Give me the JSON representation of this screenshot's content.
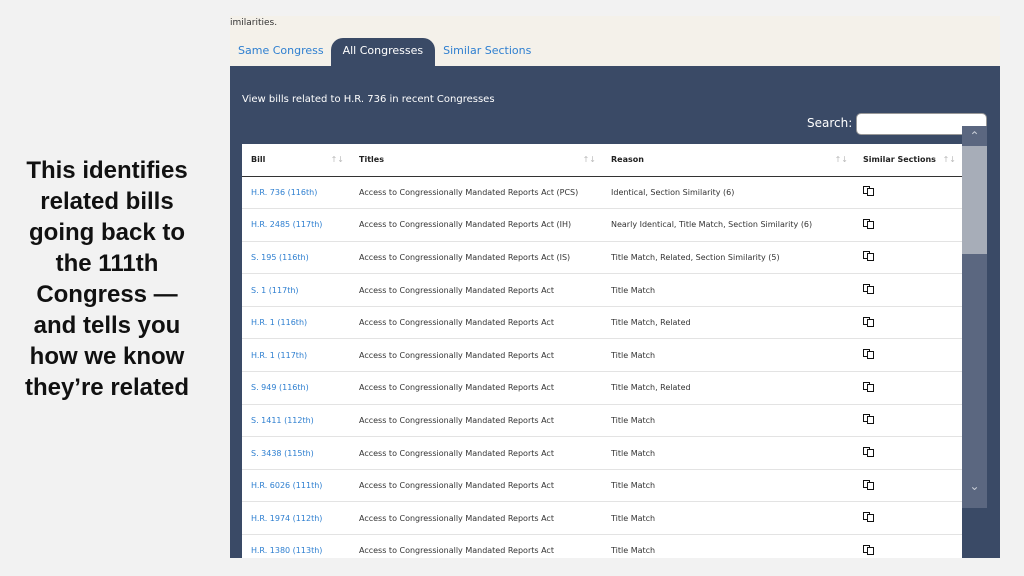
{
  "caption": "This identifies related bills going back to the 111th Congress — and tells you how we know they’re related",
  "top_text": "imilarities.",
  "tabs": [
    {
      "label": "Same Congress",
      "active": false
    },
    {
      "label": "All Congresses",
      "active": true
    },
    {
      "label": "Similar Sections",
      "active": false
    }
  ],
  "panel": {
    "description": "View bills related to H.R. 736 in recent Congresses",
    "search_label": "Search:",
    "search_value": ""
  },
  "table": {
    "headers": [
      "Bill",
      "Titles",
      "Reason",
      "Similar Sections"
    ],
    "sort_glyph": "↑↓",
    "rows": [
      {
        "bill": "H.R. 736 (116th)",
        "title": "Access to Congressionally Mandated Reports Act (PCS)",
        "reason": "Identical, Section Similarity (6)"
      },
      {
        "bill": "H.R. 2485 (117th)",
        "title": "Access to Congressionally Mandated Reports Act (IH)",
        "reason": "Nearly Identical, Title Match, Section Similarity (6)"
      },
      {
        "bill": "S. 195 (116th)",
        "title": "Access to Congressionally Mandated Reports Act (IS)",
        "reason": "Title Match, Related, Section Similarity (5)"
      },
      {
        "bill": "S. 1 (117th)",
        "title": "Access to Congressionally Mandated Reports Act",
        "reason": "Title Match"
      },
      {
        "bill": "H.R. 1 (116th)",
        "title": "Access to Congressionally Mandated Reports Act",
        "reason": "Title Match, Related"
      },
      {
        "bill": "H.R. 1 (117th)",
        "title": "Access to Congressionally Mandated Reports Act",
        "reason": "Title Match"
      },
      {
        "bill": "S. 949 (116th)",
        "title": "Access to Congressionally Mandated Reports Act",
        "reason": "Title Match, Related"
      },
      {
        "bill": "S. 1411 (112th)",
        "title": "Access to Congressionally Mandated Reports Act",
        "reason": "Title Match"
      },
      {
        "bill": "S. 3438 (115th)",
        "title": "Access to Congressionally Mandated Reports Act",
        "reason": "Title Match"
      },
      {
        "bill": "H.R. 6026 (111th)",
        "title": "Access to Congressionally Mandated Reports Act",
        "reason": "Title Match"
      },
      {
        "bill": "H.R. 1974 (112th)",
        "title": "Access to Congressionally Mandated Reports Act",
        "reason": "Title Match"
      },
      {
        "bill": "H.R. 1380 (113th)",
        "title": "Access to Congressionally Mandated Reports Act",
        "reason": "Title Match"
      }
    ]
  },
  "icons": {
    "similar_sections": "compare-sections-icon",
    "scroll_up": "chevron-up-icon",
    "scroll_down": "chevron-down-icon"
  },
  "colors": {
    "panel": "#3a4a66",
    "link": "#2e7fd0",
    "top_strip": "#f4f1ea"
  }
}
